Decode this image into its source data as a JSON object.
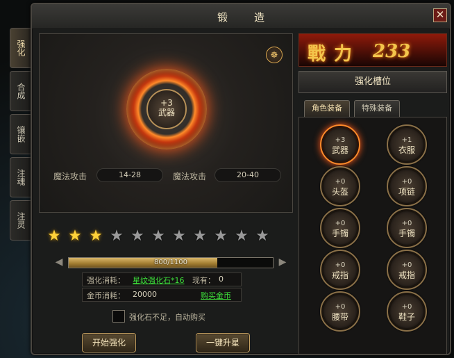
{
  "window": {
    "title": "锻造",
    "close_label": "✕"
  },
  "side_tabs": [
    "强化",
    "合成",
    "镶嵌",
    "注魂",
    "注灵"
  ],
  "forge": {
    "center_level": "+3",
    "center_item": "武器",
    "bagua_icon": "☸",
    "attr_left_label": "魔法攻击",
    "attr_left_value": "14-28",
    "attr_right_label": "魔法攻击",
    "attr_right_value": "20-40"
  },
  "stars": {
    "filled": 3,
    "total": 11
  },
  "progress": {
    "current": 800,
    "max": 1100,
    "text": "800/1100"
  },
  "cost": {
    "stone_label": "强化消耗：",
    "stone_value": "星纹强化石*16",
    "own_label": "现有：",
    "own_value": "0",
    "gold_label": "金币消耗：",
    "gold_value": "20000",
    "buy_gold": "购买金币"
  },
  "auto_buy_label": "强化石不足，自动购买",
  "buttons": {
    "start": "开始强化",
    "upgrade": "一键升星"
  },
  "power": {
    "glyph": "戰力",
    "value": "233"
  },
  "slots_header": "强化槽位",
  "subtabs": [
    "角色装备",
    "特殊装备"
  ],
  "slots": [
    {
      "level": "+3",
      "name": "武器"
    },
    {
      "level": "+1",
      "name": "衣服"
    },
    {
      "level": "+0",
      "name": "头盔"
    },
    {
      "level": "+0",
      "name": "项链"
    },
    {
      "level": "+0",
      "name": "手镯"
    },
    {
      "level": "+0",
      "name": "手镯"
    },
    {
      "level": "+0",
      "name": "戒指"
    },
    {
      "level": "+0",
      "name": "戒指"
    },
    {
      "level": "+0",
      "name": "腰带"
    },
    {
      "level": "+0",
      "name": "鞋子"
    }
  ],
  "colors": {
    "accent_gold": "#f3c54c",
    "link_green": "#3ddf3a",
    "fire": "#ff5a1a"
  }
}
